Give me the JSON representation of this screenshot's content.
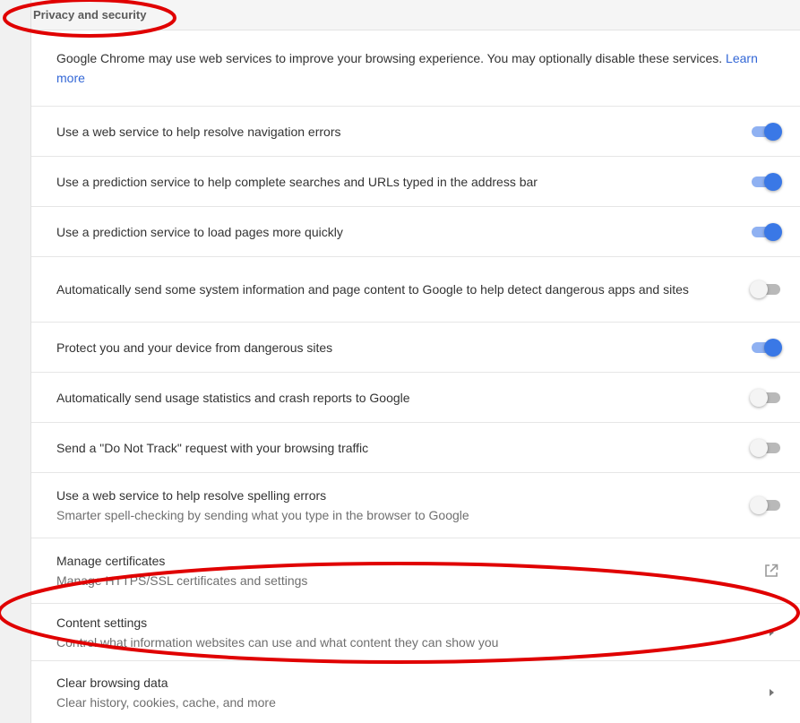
{
  "section": {
    "title": "Privacy and security"
  },
  "intro": {
    "text": "Google Chrome may use web services to improve your browsing experience. You may optionally disable these services. ",
    "link": "Learn more"
  },
  "settings": [
    {
      "label": "Use a web service to help resolve navigation errors",
      "enabled": true
    },
    {
      "label": "Use a prediction service to help complete searches and URLs typed in the address bar",
      "enabled": true
    },
    {
      "label": "Use a prediction service to load pages more quickly",
      "enabled": true
    },
    {
      "label": "Automatically send some system information and page content to Google to help detect dangerous apps and sites",
      "enabled": false
    },
    {
      "label": "Protect you and your device from dangerous sites",
      "enabled": true
    },
    {
      "label": "Automatically send usage statistics and crash reports to Google",
      "enabled": false
    },
    {
      "label": "Send a \"Do Not Track\" request with your browsing traffic",
      "enabled": false
    },
    {
      "label": "Use a web service to help resolve spelling errors",
      "sublabel": "Smarter spell-checking by sending what you type in the browser to Google",
      "enabled": false
    }
  ],
  "links": [
    {
      "label": "Manage certificates",
      "sublabel": "Manage HTTPS/SSL certificates and settings",
      "icon": "external-link-icon"
    },
    {
      "label": "Content settings",
      "sublabel": "Control what information websites can use and what content they can show you",
      "icon": "arrow-right-icon"
    },
    {
      "label": "Clear browsing data",
      "sublabel": "Clear history, cookies, cache, and more",
      "icon": "arrow-right-icon"
    }
  ],
  "colors": {
    "toggle_on": "#3a78e6",
    "toggle_off": "#b9b9b9",
    "link": "#3367d6",
    "annotation": "#e00000"
  }
}
